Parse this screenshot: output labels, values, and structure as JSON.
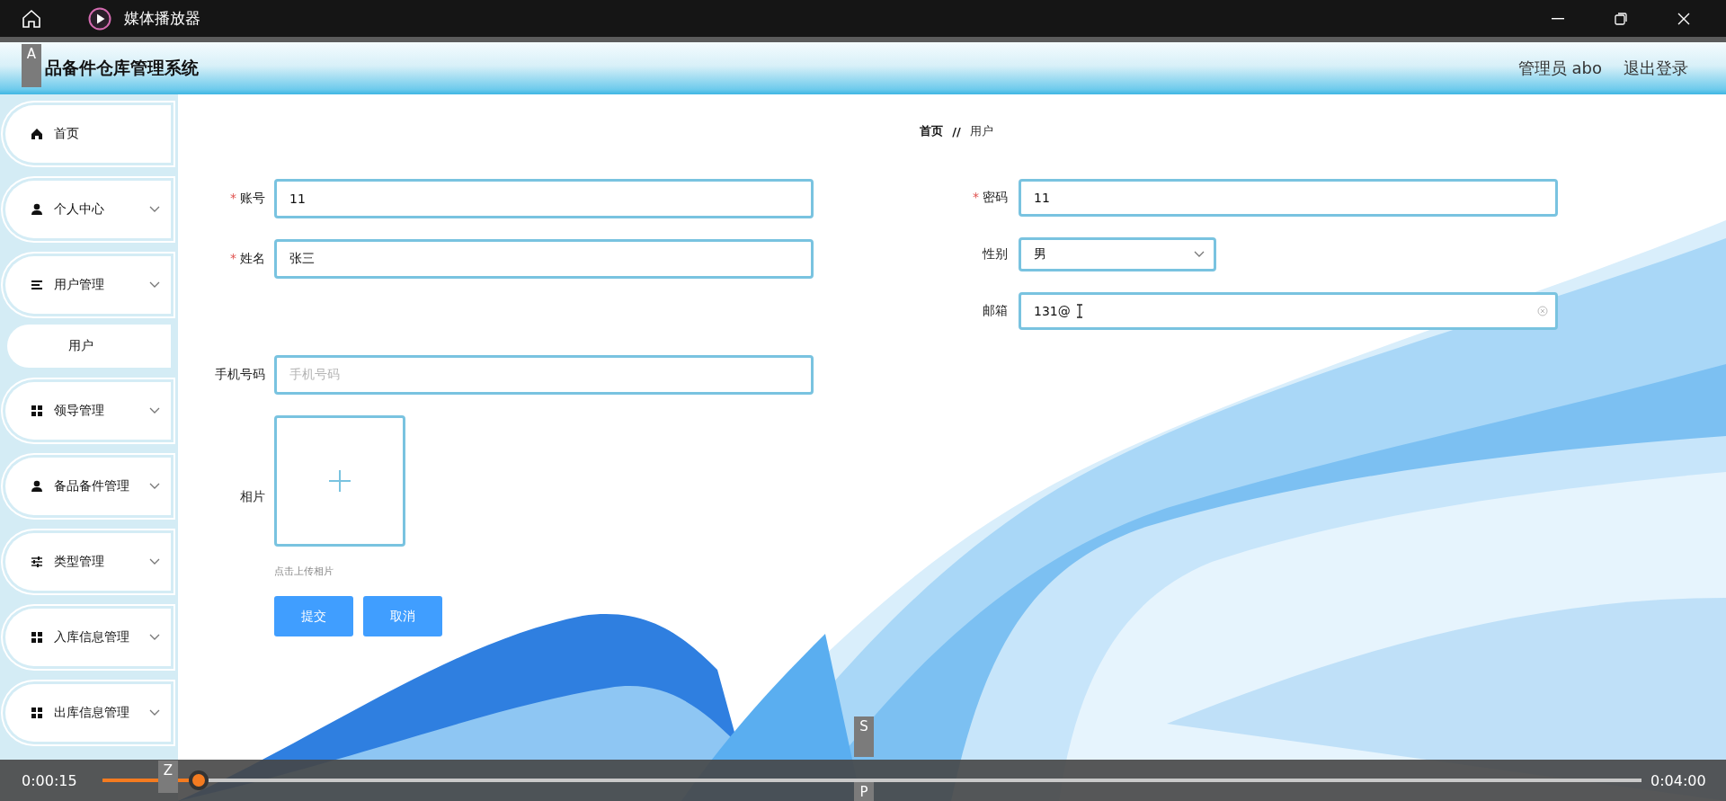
{
  "window": {
    "title": "媒体播放器"
  },
  "header": {
    "title": "品备件仓库管理系统",
    "user": "管理员 abo",
    "logout": "退出登录"
  },
  "sidebar": {
    "items": [
      {
        "label": "首页",
        "has_children": false
      },
      {
        "label": "个人中心",
        "has_children": true
      },
      {
        "label": "用户管理",
        "has_children": true,
        "children": [
          {
            "label": "用户"
          }
        ]
      },
      {
        "label": "领导管理",
        "has_children": true
      },
      {
        "label": "备品备件管理",
        "has_children": true
      },
      {
        "label": "类型管理",
        "has_children": true
      },
      {
        "label": "入库信息管理",
        "has_children": true
      },
      {
        "label": "出库信息管理",
        "has_children": true
      }
    ]
  },
  "breadcrumb": {
    "items": [
      "首页",
      "用户"
    ],
    "separator": "//"
  },
  "form": {
    "left": [
      {
        "kind": "text",
        "label": "账号",
        "required": true,
        "value": "11",
        "focused": false
      },
      {
        "kind": "text",
        "label": "姓名",
        "required": true,
        "value": "张三",
        "focused": false
      },
      {
        "kind": "text",
        "label": "手机号码",
        "required": false,
        "placeholder": "手机号码",
        "focused": false
      },
      {
        "kind": "upload",
        "label": "相片",
        "required": false,
        "hint": "点击上传相片"
      }
    ],
    "right": [
      {
        "kind": "text",
        "label": "密码",
        "required": true,
        "value": "11",
        "focused": false
      },
      {
        "kind": "select",
        "label": "性别",
        "required": false,
        "value": "男"
      },
      {
        "kind": "text",
        "label": "邮箱",
        "required": false,
        "value": "131@",
        "focused": true
      }
    ],
    "required_mark": "*",
    "buttons": [
      "提交",
      "取消"
    ]
  },
  "player": {
    "time": "0:00:15",
    "duration": "0:04:00",
    "level": 0.0625
  },
  "key_hints": [
    "A",
    "Z",
    "S",
    "P"
  ]
}
